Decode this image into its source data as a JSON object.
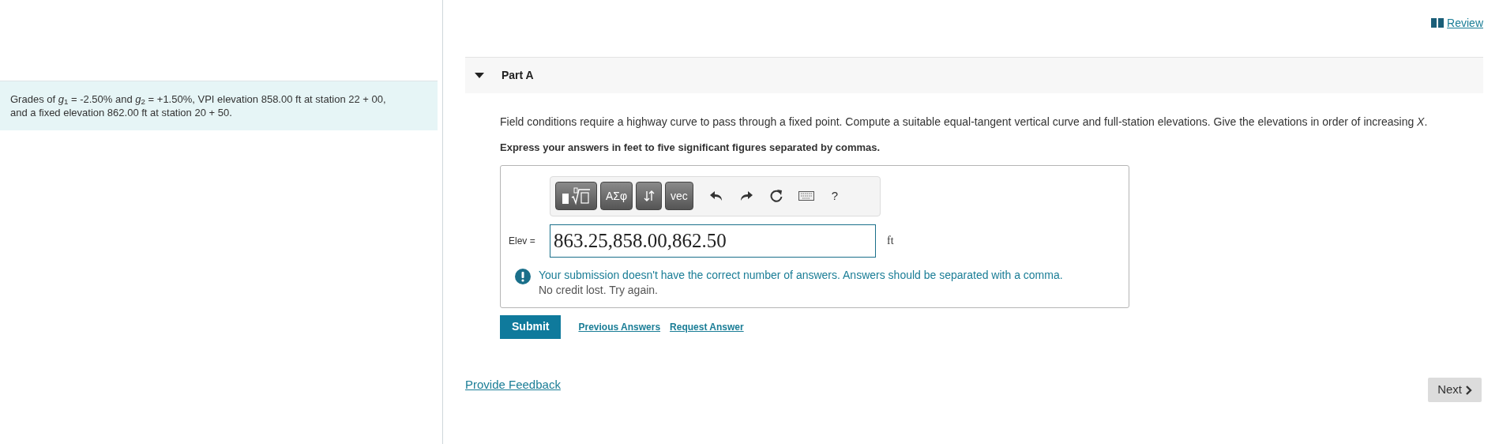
{
  "problem_statement": "Grades of *g*$_{1}$ = -2.50% and *g*$_{2}$ = +1.50%, VPI elevation 858.00 ft at station 22 + 00, and a fixed elevation 862.00 ft at station 20 + 50.",
  "review_link": "Review",
  "part": {
    "title": "Part A",
    "expanded": true,
    "instruction": "Field conditions require a highway curve to pass through a fixed point. Compute a suitable equal-tangent vertical curve and full-station elevations. Give the elevations in order of increasing *X*.",
    "requirement": "Express your answers in feet to five significant figures separated by commas.",
    "toolbar": [
      {
        "kind": "templates"
      },
      {
        "kind": "text",
        "label": "ΑΣφ"
      },
      {
        "kind": "arrows"
      },
      {
        "kind": "text",
        "label": "vec"
      },
      {
        "kind": "undo"
      },
      {
        "kind": "redo"
      },
      {
        "kind": "reset"
      },
      {
        "kind": "keyboard"
      },
      {
        "kind": "glyph",
        "label": "?"
      }
    ],
    "answer_label": "Elev =",
    "answer_value": "863.25,858.00,862.50",
    "unit": "ft",
    "feedback": {
      "message": "Your submission doesn't have the correct number of answers. Answers should be separated with a comma.",
      "note": "No credit lost. Try again."
    },
    "submit": "Submit",
    "links": [
      "Previous Answers",
      "Request Answer"
    ]
  },
  "provide_feedback": "Provide Feedback",
  "next_button": "Next"
}
